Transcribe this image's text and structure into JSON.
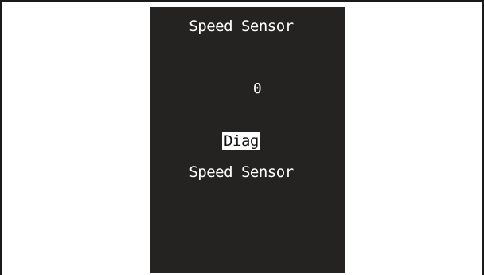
{
  "display": {
    "title": "Speed Sensor",
    "value": "0",
    "menu_selected": "Diag",
    "subtitle": "Speed Sensor"
  },
  "colors": {
    "screen_background": "#252222",
    "text": "#ffffff",
    "frame": "#1a1a1a",
    "page_background": "#ffffff"
  }
}
